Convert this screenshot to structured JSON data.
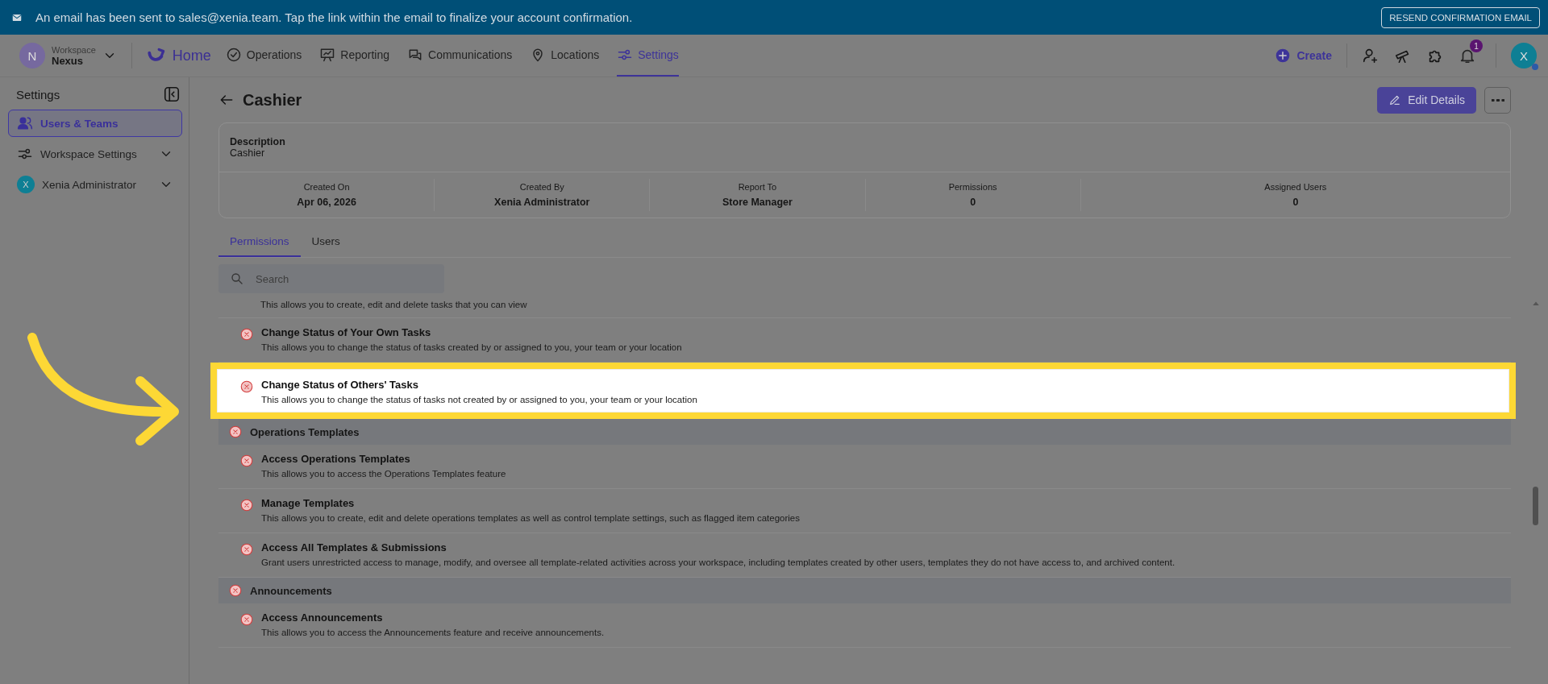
{
  "banner": {
    "message": "An email has been sent to sales@xenia.team. Tap the link within the email to finalize your account confirmation.",
    "button": "RESEND CONFIRMATION EMAIL"
  },
  "nav": {
    "workspace": {
      "initial": "N",
      "label": "Workspace",
      "name": "Nexus"
    },
    "home": "Home",
    "items": [
      {
        "label": "Operations",
        "selected": false
      },
      {
        "label": "Reporting",
        "selected": false
      },
      {
        "label": "Communications",
        "selected": false
      },
      {
        "label": "Locations",
        "selected": false
      },
      {
        "label": "Settings",
        "selected": true
      }
    ],
    "create": "Create",
    "notification_count": "1",
    "avatar": "X"
  },
  "sidebar": {
    "title": "Settings",
    "items": [
      {
        "label": "Users & Teams",
        "kind": "users",
        "selected": true,
        "expandable": false
      },
      {
        "label": "Workspace Settings",
        "kind": "sliders",
        "selected": false,
        "expandable": true
      },
      {
        "label": "Xenia Administrator",
        "kind": "avatar",
        "avatar": "X",
        "selected": false,
        "expandable": true
      }
    ]
  },
  "page": {
    "title": "Cashier",
    "edit_button": "Edit Details",
    "description": {
      "label": "Description",
      "value": "Cashier"
    },
    "stats": [
      {
        "label": "Created On",
        "value": "Apr 06, 2026"
      },
      {
        "label": "Created By",
        "value": "Xenia Administrator"
      },
      {
        "label": "Report To",
        "value": "Store Manager"
      },
      {
        "label": "Permissions",
        "value": "0"
      },
      {
        "label": "Assigned Users",
        "value": "0"
      }
    ],
    "tabs": [
      {
        "label": "Permissions",
        "selected": true
      },
      {
        "label": "Users",
        "selected": false
      }
    ],
    "search": {
      "placeholder": "Search"
    },
    "permissions": [
      {
        "kind": "note",
        "description": "This allows you to create, edit and delete tasks that you can view"
      },
      {
        "kind": "permission",
        "title": "Change Status of Your Own Tasks",
        "description": "This allows you to change the status of tasks created by or assigned to you, your team or your location",
        "granted": false,
        "highlighted": false
      },
      {
        "kind": "permission",
        "title": "Change Status of Others' Tasks",
        "description": "This allows you to change the status of tasks not created by or assigned to you, your team or your location",
        "granted": false,
        "highlighted": true
      },
      {
        "kind": "group",
        "title": "Operations Templates",
        "granted": false
      },
      {
        "kind": "permission",
        "title": "Access Operations Templates",
        "description": "This allows you to access the Operations Templates feature",
        "granted": false,
        "highlighted": false
      },
      {
        "kind": "permission",
        "title": "Manage Templates",
        "description": "This allows you to create, edit and delete operations templates as well as control template settings, such as flagged item categories",
        "granted": false,
        "highlighted": false
      },
      {
        "kind": "permission",
        "title": "Access All Templates & Submissions",
        "description": "Grant users unrestricted access to manage, modify, and oversee all template-related activities across your workspace, including templates created by other users, templates they do not have access to, and archived content.",
        "granted": false,
        "highlighted": false
      },
      {
        "kind": "group",
        "title": "Announcements",
        "granted": false
      },
      {
        "kind": "permission",
        "title": "Access Announcements",
        "description": "This allows you to access the Announcements feature and receive announcements.",
        "granted": false,
        "highlighted": false
      }
    ]
  }
}
